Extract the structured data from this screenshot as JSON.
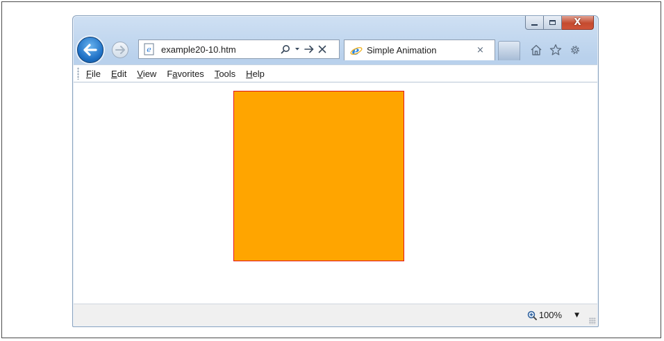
{
  "window": {
    "caption": {
      "minimize_icon": "minimize-icon",
      "maximize_icon": "maximize-icon",
      "close_glyph": "X"
    },
    "address_bar": {
      "url": "example20-10.htm",
      "icons": [
        "page-icon",
        "search-icon",
        "dropdown-icon",
        "go-arrow-icon",
        "stop-icon"
      ]
    },
    "tab": {
      "title": "Simple Animation",
      "close_glyph": "×"
    },
    "toolbar_icons": [
      "home-icon",
      "favorites-star-icon",
      "settings-gear-icon"
    ]
  },
  "menubar": {
    "items": [
      {
        "accel": "F",
        "rest": "ile"
      },
      {
        "accel": "E",
        "rest": "dit"
      },
      {
        "accel": "V",
        "rest": "iew"
      },
      {
        "pre": "F",
        "accel": "a",
        "rest": "vorites"
      },
      {
        "accel": "T",
        "rest": "ools"
      },
      {
        "accel": "H",
        "rest": "elp"
      }
    ]
  },
  "content": {
    "box_fill_color": "#ffa500",
    "box_border_color": "#e0141e"
  },
  "statusbar": {
    "zoom": "100%",
    "zoom_dropdown_glyph": "▼"
  },
  "colors": {
    "back_button": "#1d6fc4",
    "close_button": "#c44a2e"
  }
}
